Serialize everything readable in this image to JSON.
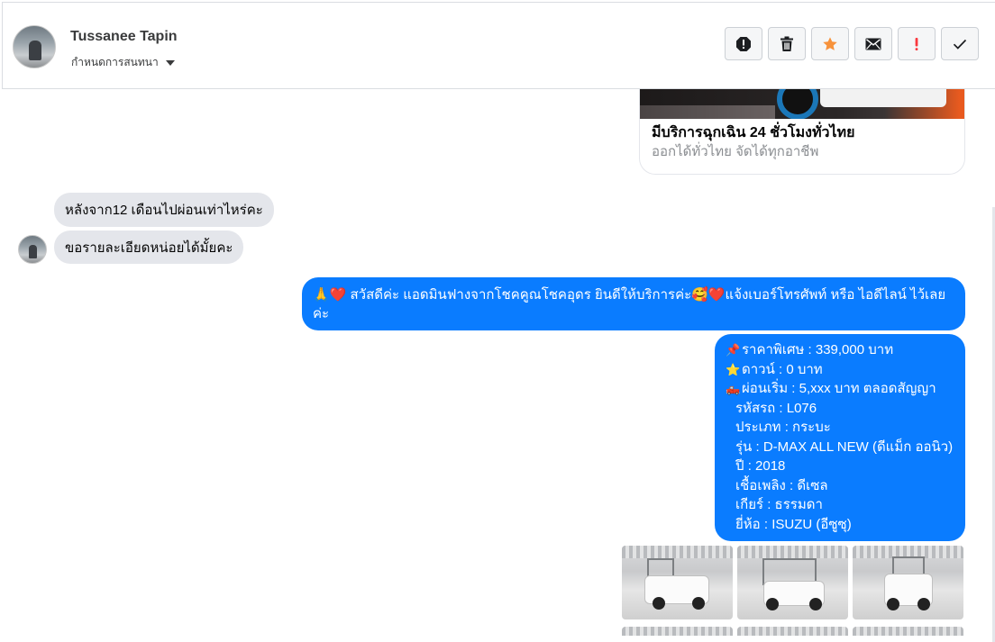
{
  "header": {
    "name": "Tussanee Tapin",
    "subtitle": "กำหนดการสนทนา"
  },
  "actions": [
    {
      "name": "report-icon",
      "color": "#1c1e21"
    },
    {
      "name": "trash-icon",
      "color": "#1c1e21"
    },
    {
      "name": "star-icon",
      "color": "#f7923b"
    },
    {
      "name": "envelope-icon",
      "color": "#1c1e21"
    },
    {
      "name": "exclamation-icon",
      "color": "#fa383e"
    },
    {
      "name": "checkmark-icon",
      "color": "#1c1e21"
    }
  ],
  "link_card": {
    "title": "มีบริการฉุกเฉิน 24 ชั่วโมงทั่วไทย",
    "description": "ออกได้ทั่วไทย จัดได้ทุกอาชีพ"
  },
  "incoming": [
    {
      "text": "หลังจาก12 เดือนไปผ่อนเท่าไหร่คะ"
    },
    {
      "text": "ขอรายละเอียดหน่อยได้มั้ยคะ"
    }
  ],
  "greeting": {
    "text": "🙏❤️ สวัสดีค่ะ แอดมินฟางจากโชคคูณโชคอุดร ยินดีให้บริการค่ะ🥰❤️แจ้งเบอร์โทรศัพท์ หรือ ไอดีไลน์  ไว้เลยค่ะ"
  },
  "details": {
    "lines": [
      {
        "icon": "📌",
        "text": "ราคาพิเศษ : 339,000 บาท"
      },
      {
        "icon": "⭐",
        "text": "ดาวน์ : 0 บาท"
      },
      {
        "icon": "🛻",
        "text": "ผ่อนเริ่ม : 5,xxx บาท ตลอดสัญญา"
      },
      {
        "icon": "",
        "text": "รหัสรถ : L076"
      },
      {
        "icon": "",
        "text": "ประเภท : กระบะ"
      },
      {
        "icon": "",
        "text": "รุ่น : D-MAX ALL NEW (ดีแม็ก ออนิว)"
      },
      {
        "icon": "",
        "text": "ปี : 2018"
      },
      {
        "icon": "",
        "text": "เชื้อเพลิง : ดีเซล"
      },
      {
        "icon": "",
        "text": "เกียร์ : ธรรมดา"
      },
      {
        "icon": "",
        "text": "ยี่ห้อ : ISUZU (อีซูซุ)"
      }
    ]
  },
  "colors": {
    "outgoing_bubble": "#0a7cff",
    "incoming_bubble": "#e4e6eb"
  }
}
